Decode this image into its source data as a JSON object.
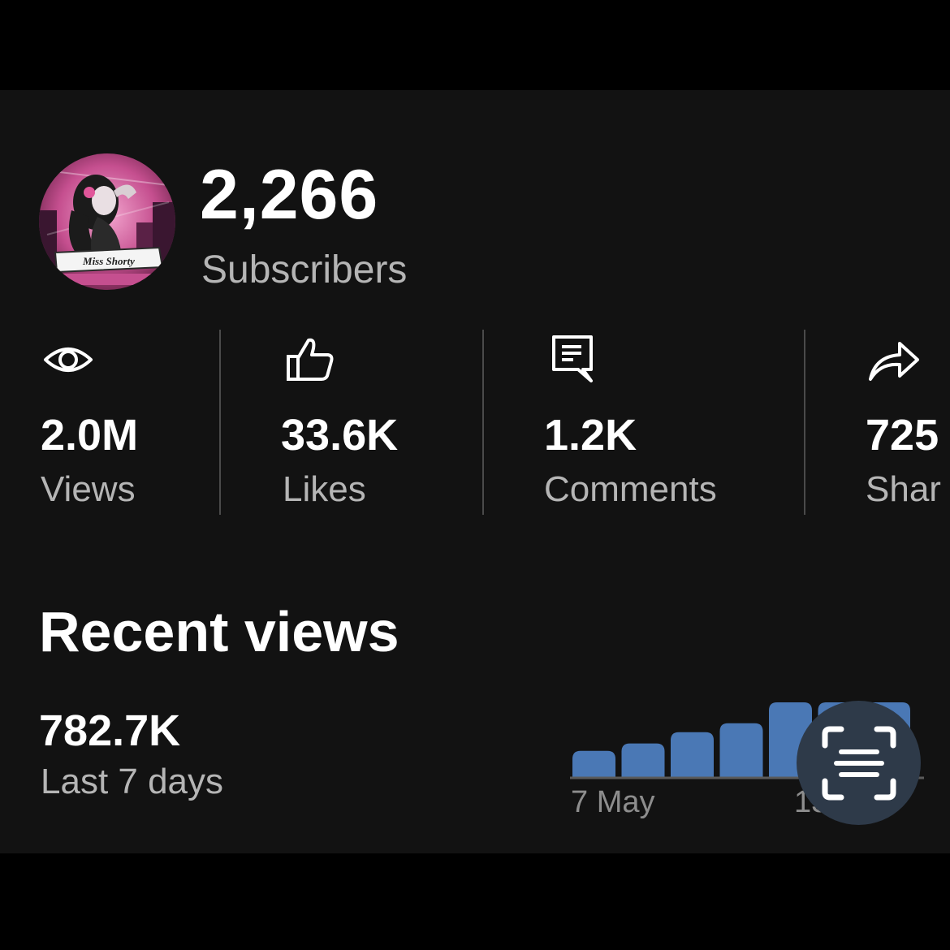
{
  "channel": {
    "avatar_text": "Miss Shorty",
    "subscriber_count": "2,266",
    "subscriber_label": "Subscribers"
  },
  "stats": [
    {
      "icon": "eye-icon",
      "value": "2.0M",
      "label": "Views"
    },
    {
      "icon": "thumbs-up-icon",
      "value": "33.6K",
      "label": "Likes"
    },
    {
      "icon": "comment-icon",
      "value": "1.2K",
      "label": "Comments"
    },
    {
      "icon": "share-icon",
      "value": "725",
      "label": "Shar"
    }
  ],
  "recent": {
    "title": "Recent views",
    "value": "782.7K",
    "period": "Last 7 days"
  },
  "chart_data": {
    "type": "bar",
    "categories": [
      "",
      "",
      "",
      "",
      "",
      "",
      ""
    ],
    "values": [
      35,
      45,
      60,
      72,
      100,
      100,
      100
    ],
    "x_tick_labels": [
      "7 May",
      "13 May"
    ],
    "bar_color": "#4a78b5"
  },
  "scan_button": {
    "icon": "live-text-scan-icon"
  },
  "colors": {
    "background": "#121212",
    "text_primary": "#ffffff",
    "text_secondary": "#b5b5b5",
    "accent_pink": "#e0569a"
  }
}
